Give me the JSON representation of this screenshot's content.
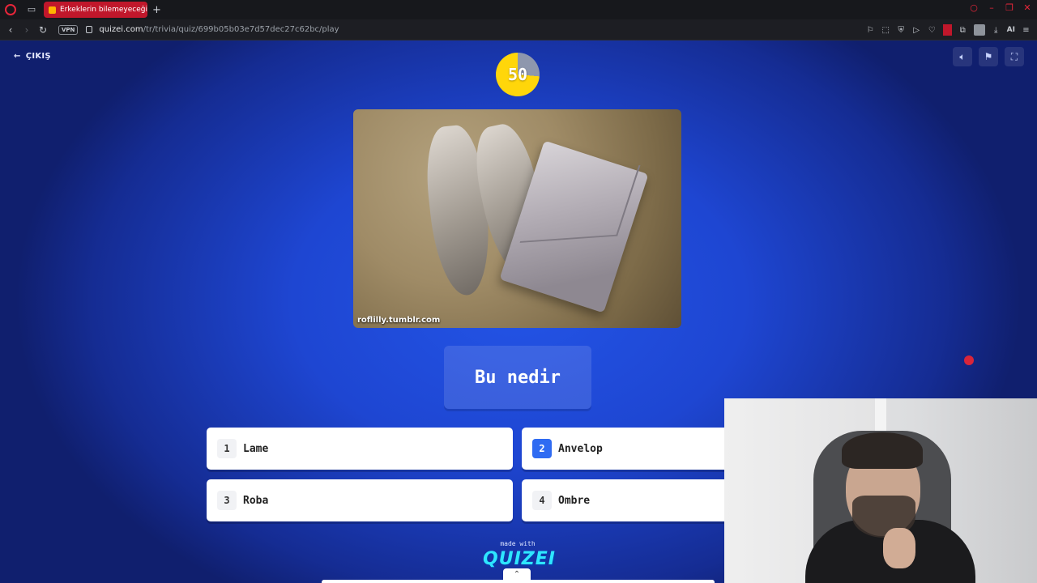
{
  "browser": {
    "tab_title": "Erkeklerin bilemeyeceği şe",
    "vpn_label": "VPN",
    "url_host": "quizei.com",
    "url_path": "/tr/trivia/quiz/699b05b03e7d57dec27c62bc/play",
    "ai_label": "AI"
  },
  "quiz": {
    "exit_label": "ÇIKIŞ",
    "timer": "50",
    "image_watermark": "roflilly.tumblr.com",
    "question": "Bu nedir",
    "answers": [
      {
        "number": "1",
        "text": "Lame"
      },
      {
        "number": "2",
        "text": "Anvelop"
      },
      {
        "number": "3",
        "text": "Roba"
      },
      {
        "number": "4",
        "text": "Ombre"
      }
    ],
    "made_with": "made with",
    "brand": "QUIZEI"
  },
  "icons": {
    "exit": "arrow-left-icon",
    "sound": "volume-icon",
    "report": "flag-icon",
    "fullscreen": "fullscreen-icon",
    "up": "chevron-up-icon"
  },
  "colors": {
    "accent_blue": "#2f6bf2",
    "timer_yellow": "#ffd60a",
    "browser_red": "#c0172b"
  }
}
